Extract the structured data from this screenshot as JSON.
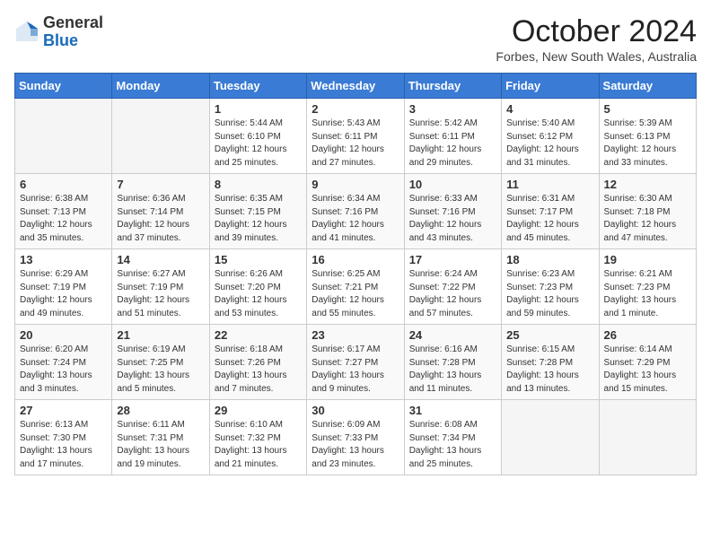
{
  "header": {
    "logo_general": "General",
    "logo_blue": "Blue",
    "month_year": "October 2024",
    "location": "Forbes, New South Wales, Australia"
  },
  "days_of_week": [
    "Sunday",
    "Monday",
    "Tuesday",
    "Wednesday",
    "Thursday",
    "Friday",
    "Saturday"
  ],
  "weeks": [
    [
      {
        "day": "",
        "info": ""
      },
      {
        "day": "",
        "info": ""
      },
      {
        "day": "1",
        "info": "Sunrise: 5:44 AM\nSunset: 6:10 PM\nDaylight: 12 hours and 25 minutes."
      },
      {
        "day": "2",
        "info": "Sunrise: 5:43 AM\nSunset: 6:11 PM\nDaylight: 12 hours and 27 minutes."
      },
      {
        "day": "3",
        "info": "Sunrise: 5:42 AM\nSunset: 6:11 PM\nDaylight: 12 hours and 29 minutes."
      },
      {
        "day": "4",
        "info": "Sunrise: 5:40 AM\nSunset: 6:12 PM\nDaylight: 12 hours and 31 minutes."
      },
      {
        "day": "5",
        "info": "Sunrise: 5:39 AM\nSunset: 6:13 PM\nDaylight: 12 hours and 33 minutes."
      }
    ],
    [
      {
        "day": "6",
        "info": "Sunrise: 6:38 AM\nSunset: 7:13 PM\nDaylight: 12 hours and 35 minutes."
      },
      {
        "day": "7",
        "info": "Sunrise: 6:36 AM\nSunset: 7:14 PM\nDaylight: 12 hours and 37 minutes."
      },
      {
        "day": "8",
        "info": "Sunrise: 6:35 AM\nSunset: 7:15 PM\nDaylight: 12 hours and 39 minutes."
      },
      {
        "day": "9",
        "info": "Sunrise: 6:34 AM\nSunset: 7:16 PM\nDaylight: 12 hours and 41 minutes."
      },
      {
        "day": "10",
        "info": "Sunrise: 6:33 AM\nSunset: 7:16 PM\nDaylight: 12 hours and 43 minutes."
      },
      {
        "day": "11",
        "info": "Sunrise: 6:31 AM\nSunset: 7:17 PM\nDaylight: 12 hours and 45 minutes."
      },
      {
        "day": "12",
        "info": "Sunrise: 6:30 AM\nSunset: 7:18 PM\nDaylight: 12 hours and 47 minutes."
      }
    ],
    [
      {
        "day": "13",
        "info": "Sunrise: 6:29 AM\nSunset: 7:19 PM\nDaylight: 12 hours and 49 minutes."
      },
      {
        "day": "14",
        "info": "Sunrise: 6:27 AM\nSunset: 7:19 PM\nDaylight: 12 hours and 51 minutes."
      },
      {
        "day": "15",
        "info": "Sunrise: 6:26 AM\nSunset: 7:20 PM\nDaylight: 12 hours and 53 minutes."
      },
      {
        "day": "16",
        "info": "Sunrise: 6:25 AM\nSunset: 7:21 PM\nDaylight: 12 hours and 55 minutes."
      },
      {
        "day": "17",
        "info": "Sunrise: 6:24 AM\nSunset: 7:22 PM\nDaylight: 12 hours and 57 minutes."
      },
      {
        "day": "18",
        "info": "Sunrise: 6:23 AM\nSunset: 7:23 PM\nDaylight: 12 hours and 59 minutes."
      },
      {
        "day": "19",
        "info": "Sunrise: 6:21 AM\nSunset: 7:23 PM\nDaylight: 13 hours and 1 minute."
      }
    ],
    [
      {
        "day": "20",
        "info": "Sunrise: 6:20 AM\nSunset: 7:24 PM\nDaylight: 13 hours and 3 minutes."
      },
      {
        "day": "21",
        "info": "Sunrise: 6:19 AM\nSunset: 7:25 PM\nDaylight: 13 hours and 5 minutes."
      },
      {
        "day": "22",
        "info": "Sunrise: 6:18 AM\nSunset: 7:26 PM\nDaylight: 13 hours and 7 minutes."
      },
      {
        "day": "23",
        "info": "Sunrise: 6:17 AM\nSunset: 7:27 PM\nDaylight: 13 hours and 9 minutes."
      },
      {
        "day": "24",
        "info": "Sunrise: 6:16 AM\nSunset: 7:28 PM\nDaylight: 13 hours and 11 minutes."
      },
      {
        "day": "25",
        "info": "Sunrise: 6:15 AM\nSunset: 7:28 PM\nDaylight: 13 hours and 13 minutes."
      },
      {
        "day": "26",
        "info": "Sunrise: 6:14 AM\nSunset: 7:29 PM\nDaylight: 13 hours and 15 minutes."
      }
    ],
    [
      {
        "day": "27",
        "info": "Sunrise: 6:13 AM\nSunset: 7:30 PM\nDaylight: 13 hours and 17 minutes."
      },
      {
        "day": "28",
        "info": "Sunrise: 6:11 AM\nSunset: 7:31 PM\nDaylight: 13 hours and 19 minutes."
      },
      {
        "day": "29",
        "info": "Sunrise: 6:10 AM\nSunset: 7:32 PM\nDaylight: 13 hours and 21 minutes."
      },
      {
        "day": "30",
        "info": "Sunrise: 6:09 AM\nSunset: 7:33 PM\nDaylight: 13 hours and 23 minutes."
      },
      {
        "day": "31",
        "info": "Sunrise: 6:08 AM\nSunset: 7:34 PM\nDaylight: 13 hours and 25 minutes."
      },
      {
        "day": "",
        "info": ""
      },
      {
        "day": "",
        "info": ""
      }
    ]
  ]
}
